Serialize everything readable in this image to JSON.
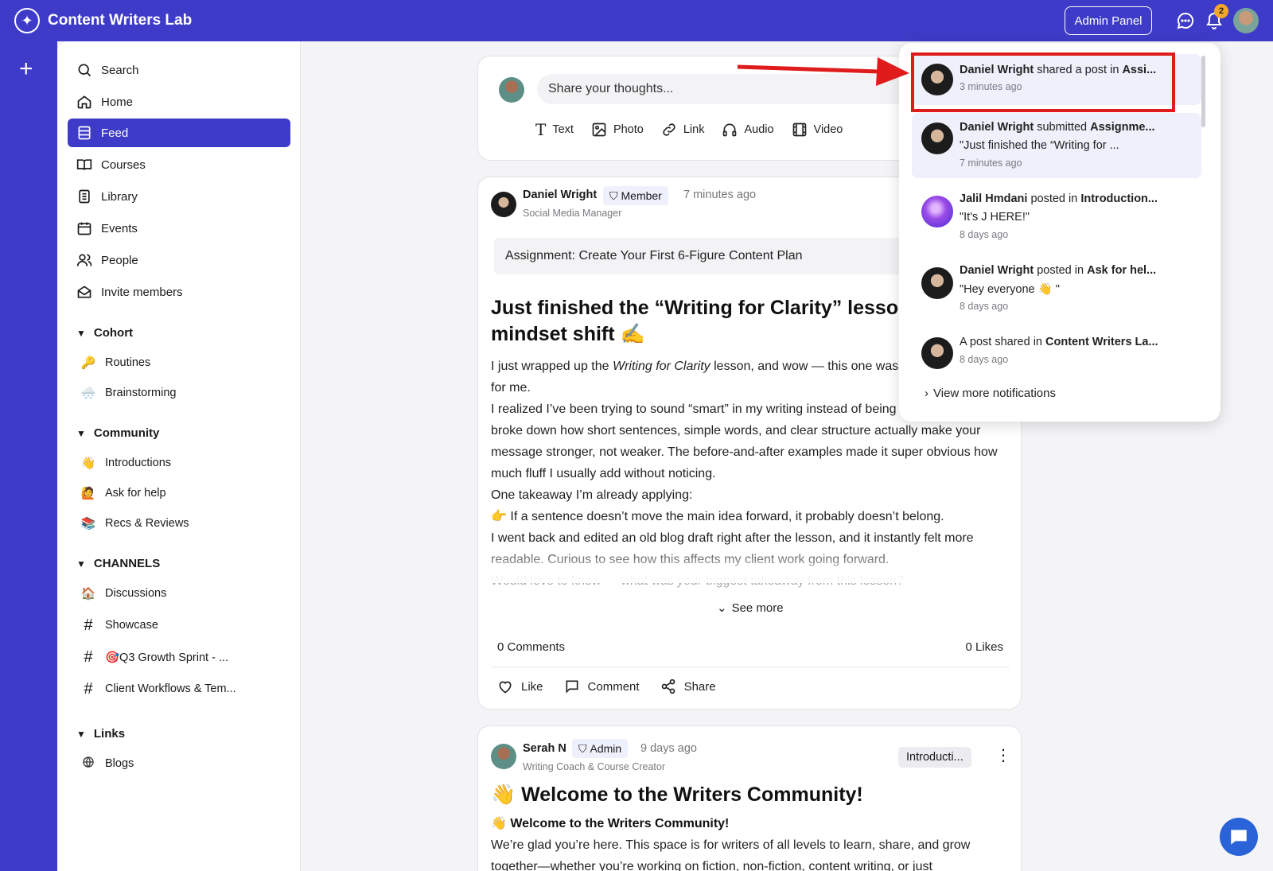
{
  "app": {
    "name": "Content Writers Lab",
    "admin_panel_label": "Admin Panel",
    "notification_count": "2"
  },
  "sidebar": {
    "nav": [
      {
        "label": "Search",
        "icon": "search-icon"
      },
      {
        "label": "Home",
        "icon": "home-icon"
      },
      {
        "label": "Feed",
        "icon": "feed-icon",
        "active": true
      },
      {
        "label": "Courses",
        "icon": "book-icon"
      },
      {
        "label": "Library",
        "icon": "document-icon"
      },
      {
        "label": "Events",
        "icon": "calendar-icon"
      },
      {
        "label": "People",
        "icon": "people-icon"
      },
      {
        "label": "Invite members",
        "icon": "envelope-icon"
      }
    ],
    "cohort": {
      "title": "Cohort",
      "items": [
        {
          "emoji": "🔑",
          "label": "Routines"
        },
        {
          "emoji": "🌨️",
          "label": "Brainstorming"
        }
      ]
    },
    "community": {
      "title": "Community",
      "items": [
        {
          "emoji": "👋",
          "label": "Introductions"
        },
        {
          "emoji": "🙋",
          "label": "Ask for help"
        },
        {
          "emoji": "📚",
          "label": "Recs & Reviews"
        }
      ]
    },
    "channels": {
      "title": "CHANNELS",
      "items": [
        {
          "emoji": "🏠",
          "label": "Discussions"
        },
        {
          "emoji": "#",
          "label": "Showcase"
        },
        {
          "emoji": "#",
          "label": "🎯Q3 Growth Sprint - ..."
        },
        {
          "emoji": "#",
          "label": "Client Workflows & Tem..."
        }
      ]
    },
    "links": {
      "title": "Links",
      "items": [
        {
          "emoji": "globe",
          "label": "Blogs"
        }
      ]
    }
  },
  "composer": {
    "placeholder": "Share your thoughts...",
    "types": [
      "Text",
      "Photo",
      "Link",
      "Audio",
      "Video"
    ]
  },
  "post1": {
    "author": "Daniel Wright",
    "role": "Member",
    "time": "7 minutes ago",
    "subtitle": "Social Media Manager",
    "assignment": "Assignment: Create Your First 6-Figure Content Plan",
    "heading": "Just finished the “Writing for Clarity” lesson — mindset shift ✍️",
    "body": {
      "p1_start": "I just wrapped up the ",
      "p1_em": "Writing for Clarity",
      "p1_end": " lesson, and wow — this one was a real eye-opener for me.",
      "p2": "I realized I’ve been trying to sound “smart” in my writing instead of being clear. The lesson broke down how short sentences, simple words, and clear structure actually make your message stronger, not weaker. The before-and-after examples made it super obvious how much fluff I usually add without noticing.",
      "p3": "One takeaway I’m already applying:",
      "p4": "👉 If a sentence doesn’t move the main idea forward, it probably doesn’t belong.",
      "p5": "I went back and edited an old blog draft right after the lesson, and it instantly felt more readable. Curious to see how this affects my client work going forward.",
      "p6_start": "Would love to know — what was ",
      "p6_em": "your",
      "p6_end": " biggest takeaway from this lesson?"
    },
    "see_more": "See more",
    "comments": "0 Comments",
    "likes": "0 Likes",
    "actions": [
      "Like",
      "Comment",
      "Share"
    ]
  },
  "post2": {
    "author": "Serah N",
    "role": "Admin",
    "time": "9 days ago",
    "subtitle": "Writing Coach & Course Creator",
    "topic": "Introducti...",
    "heading": "👋 Welcome to the Writers Community!",
    "sub_heading": "👋 Welcome to the Writers Community!",
    "body": "We’re glad you’re here. This space is for writers of all levels to learn, share, and grow together—whether you’re working on fiction, non-fiction, content writing, or just"
  },
  "notifications": [
    {
      "actor": "Daniel Wright",
      "verb": " shared a post in ",
      "target": "Assi...",
      "preview": "",
      "time": "3 minutes ago",
      "unread": true,
      "avatar": "man"
    },
    {
      "actor": "Daniel Wright",
      "verb": " submitted ",
      "target": "Assignme...",
      "preview": "\"Just finished the “Writing for ...",
      "time": "7 minutes ago",
      "unread": true,
      "avatar": "man"
    },
    {
      "actor": "Jalil Hmdani",
      "verb": " posted in ",
      "target": "Introduction...",
      "preview": "\"It's J HERE!\"",
      "time": "8 days ago",
      "unread": false,
      "avatar": "purple"
    },
    {
      "actor": "Daniel Wright",
      "verb": " posted in ",
      "target": "Ask for hel...",
      "preview": "\"Hey everyone 👋 \"",
      "time": "8 days ago",
      "unread": false,
      "avatar": "man"
    },
    {
      "actor": "",
      "verb": "A post shared in ",
      "target": "Content Writers La...",
      "preview": "",
      "time": "8 days ago",
      "unread": false,
      "avatar": "man"
    }
  ],
  "view_more_notifications": "View more notifications",
  "colors": {
    "brand": "#3e3bc8",
    "highlight": "#e01b1b",
    "fab": "#2a63d8"
  }
}
